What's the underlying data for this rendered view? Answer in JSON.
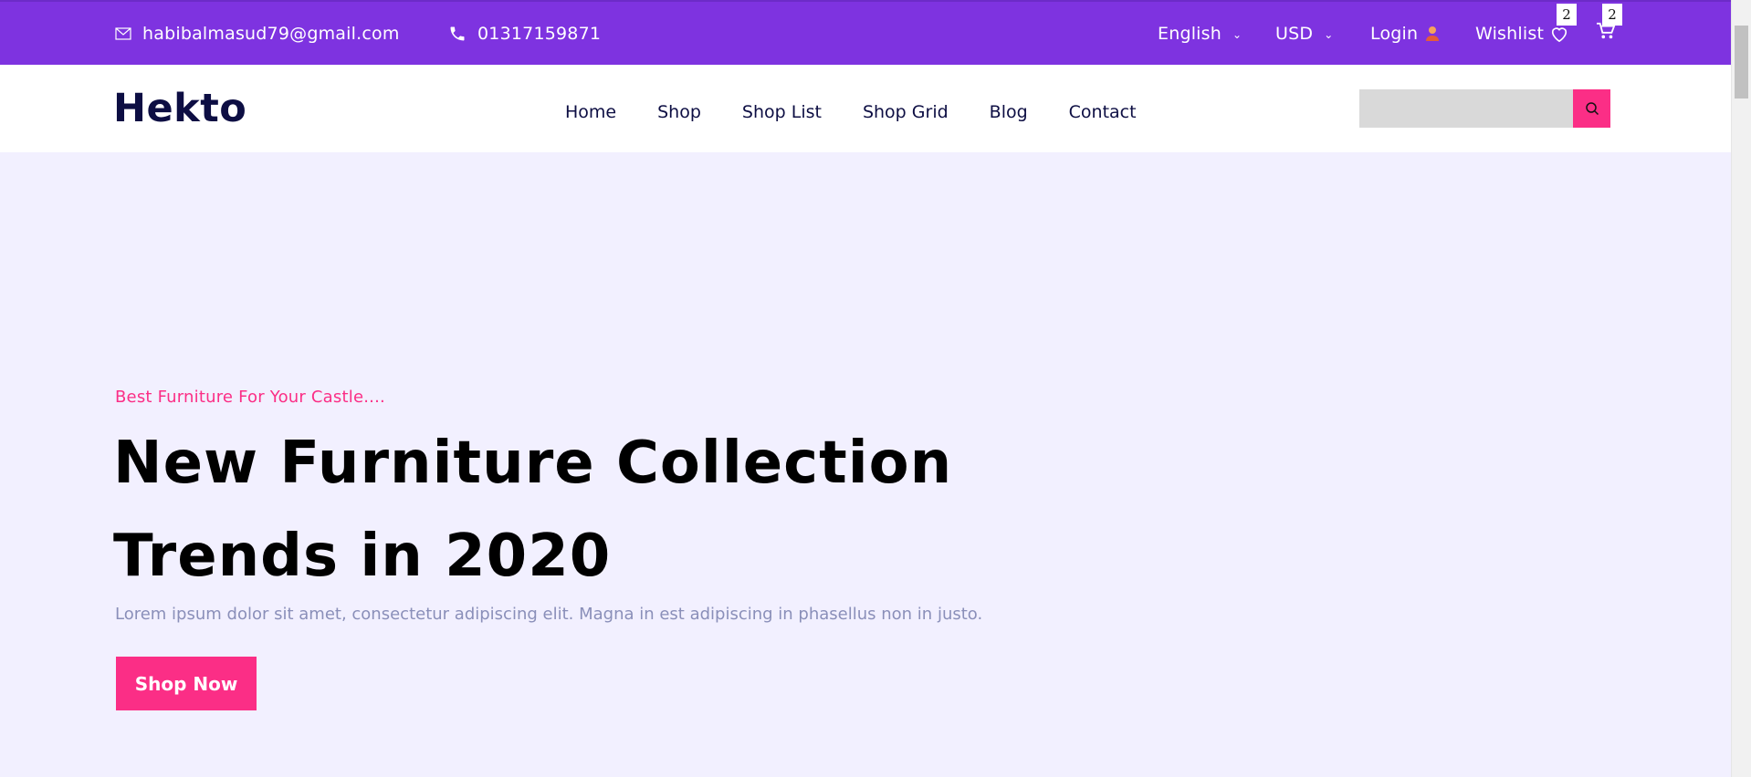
{
  "topbar": {
    "email": "habibalmasud79@gmail.com",
    "phone": "01317159871",
    "language": "English",
    "currency": "USD",
    "login_label": "Login",
    "wishlist_label": "Wishlist",
    "wishlist_count": "2",
    "cart_count": "2",
    "bg_color": "#7E33E0"
  },
  "nav": {
    "logo": "Hekto",
    "items": [
      "Home",
      "Shop",
      "Shop List",
      "Shop Grid",
      "Blog",
      "Contact"
    ],
    "search_placeholder": "",
    "search_icon": "search-icon"
  },
  "hero": {
    "tagline": "Best Furniture For Your Castle....",
    "headline_line1": "New Furniture Collection",
    "headline_line2": "Trends in 2020",
    "description": "Lorem ipsum dolor sit amet, consectetur adipiscing elit. Magna in est adipiscing in phasellus non in justo.",
    "cta_label": "Shop Now",
    "accent_color": "#FB2E86",
    "bg_color": "#F2F0FF"
  }
}
